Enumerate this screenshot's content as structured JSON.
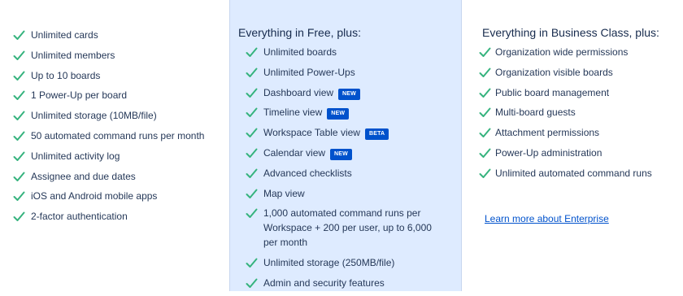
{
  "accent": "#0052cc",
  "check_color": "#36b37e",
  "free": {
    "features": [
      "Unlimited cards",
      "Unlimited members",
      "Up to 10 boards",
      "1 Power-Up per board",
      "Unlimited storage (10MB/file)",
      "50 automated command runs per month",
      "Unlimited activity log",
      "Assignee and due dates",
      "iOS and Android mobile apps",
      "2-factor authentication"
    ]
  },
  "standard": {
    "heading": "Everything in Free, plus:",
    "features": [
      {
        "label": "Unlimited boards",
        "badge": ""
      },
      {
        "label": "Unlimited Power-Ups",
        "badge": ""
      },
      {
        "label": "Dashboard view",
        "badge": "NEW"
      },
      {
        "label": "Timeline view",
        "badge": "NEW"
      },
      {
        "label": "Workspace Table view",
        "badge": "BETA"
      },
      {
        "label": "Calendar view",
        "badge": "NEW"
      },
      {
        "label": "Advanced checklists",
        "badge": ""
      },
      {
        "label": "Map view",
        "badge": ""
      },
      {
        "label": "1,000 automated command runs per Workspace + 200 per user, up to 6,000 per month",
        "badge": ""
      },
      {
        "label": "Unlimited storage (250MB/file)",
        "badge": ""
      },
      {
        "label": "Admin and security features",
        "badge": ""
      }
    ]
  },
  "enterprise": {
    "heading": "Everything in Business Class, plus:",
    "features": [
      "Organization wide permissions",
      "Organization visible boards",
      "Public board management",
      "Multi-board guests",
      "Attachment permissions",
      "Power-Up administration",
      "Unlimited automated command runs"
    ],
    "link_label": "Learn more about Enterprise"
  }
}
